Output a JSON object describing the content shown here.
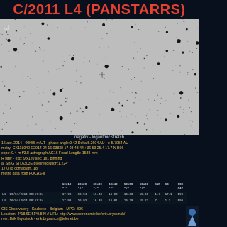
{
  "title": "C/2011 L4 (PANSTARRS)",
  "caption": "negativ - logaritmic stretch",
  "info_lines": [
    "16 apr.  2014 - 00h55 m UT - phase angle:9.42    Delta:5.2604  AU - r: 5.7054  AU",
    "metry: CK11L040  C2014 04 16.03838 17 08 48.44 +36 53 25.4        17.7 N     B96",
    "cope: 0.4-m f/3.8 astrograph AG16  Focal Length: 1538 mm",
    "R filter - exp: 9 x120 sec; 1x1 binning",
    "a: SBIG STL6303E   pixelresolution:1.224\"",
    "17.0  @ comadiam. 18\"",
    "metric data from FOCAS-II"
  ],
  "table": {
    "headers": [
      "",
      "",
      "10x10",
      "20x20",
      "30x30",
      "40x40",
      "50x50",
      "60x60",
      "SNR",
      "SB",
      "COD"
    ],
    "subheaders": [
      "",
      "",
      "\"/\"",
      "\"/\"",
      "\"/\"",
      "\"/\"",
      "\"/\"",
      "\"/\"",
      "",
      "",
      "CAT"
    ],
    "rows": [
      [
        "L4",
        "16/04/2014 00:57:44",
        "17.98",
        "16.94",
        "16.43",
        "16.09",
        "15.63",
        "15.68",
        "1.7",
        "17.1",
        "B96"
      ],
      [
        "L4",
        "16/04/2014 00:57:44",
        "17.98",
        "16.93",
        "16.38",
        "16.01",
        "15.39",
        "15.23",
        "7",
        "1.7",
        "B96"
      ]
    ]
  },
  "footer_lines": [
    "CIS Observatory - Kruibeke - Belgium - MPC: B96",
    "Location: 4°18.6E  51°9.8 N   //  URL: http://www.astronomie.be/erik.bryssinck/",
    "rver: Erik Bryssinck - erik.bryssinck@telenet.be"
  ],
  "colors": {
    "title": "#e64030",
    "info_text": "#f2c24a",
    "background": "#07101c",
    "sky": "#bdbdbd"
  }
}
